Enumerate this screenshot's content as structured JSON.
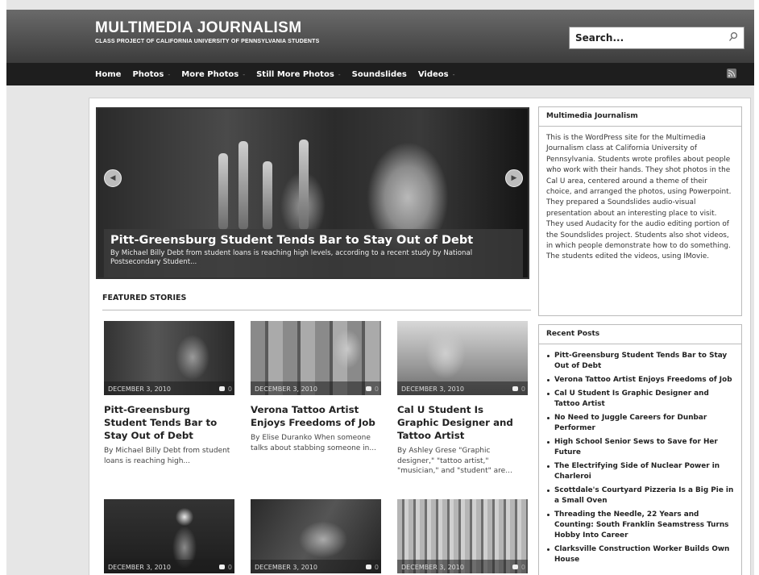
{
  "site": {
    "title": "MULTIMEDIA JOURNALISM",
    "tagline": "CLASS PROJECT OF CALIFORNIA UNIVERSITY OF PENNSYLVANIA STUDENTS"
  },
  "search": {
    "placeholder": "Search..."
  },
  "nav": {
    "items": [
      {
        "label": "Home",
        "has_dropdown": false
      },
      {
        "label": "Photos",
        "has_dropdown": true
      },
      {
        "label": "More Photos",
        "has_dropdown": true
      },
      {
        "label": "Still More Photos",
        "has_dropdown": true
      },
      {
        "label": "Soundslides",
        "has_dropdown": false
      },
      {
        "label": "Videos",
        "has_dropdown": true
      }
    ],
    "dropdown_glyph": "-",
    "rss_icon": "rss-icon"
  },
  "slider": {
    "title": "Pitt-Greensburg Student Tends Bar to Stay Out of Debt",
    "excerpt": "By Michael Billy Debt from student loans is reaching high levels, according to a recent study by National Postsecondary Student...",
    "prev_icon": "arrow-left-icon",
    "next_icon": "arrow-right-icon"
  },
  "featured": {
    "heading": "FEATURED STORIES",
    "cards": [
      {
        "date": "DECEMBER 3, 2010",
        "comments": "0",
        "title": "Pitt-Greensburg Student Tends Bar to Stay Out of Debt",
        "excerpt": "By Michael Billy Debt from student loans is reaching high..."
      },
      {
        "date": "DECEMBER 3, 2010",
        "comments": "0",
        "title": "Verona Tattoo Artist Enjoys Freedoms of Job",
        "excerpt": "By Elise Duranko When someone talks about stabbing someone in..."
      },
      {
        "date": "DECEMBER 3, 2010",
        "comments": "0",
        "title": "Cal U Student Is Graphic Designer and Tattoo Artist",
        "excerpt": "By Ashley Grese \"Graphic designer,\" \"tattoo artist,\" \"musician,\" and \"student\" are..."
      },
      {
        "date": "DECEMBER 3, 2010",
        "comments": "0",
        "title": "",
        "excerpt": ""
      },
      {
        "date": "DECEMBER 3, 2010",
        "comments": "0",
        "title": "",
        "excerpt": ""
      },
      {
        "date": "DECEMBER 3, 2010",
        "comments": "0",
        "title": "",
        "excerpt": ""
      }
    ]
  },
  "sidebar": {
    "about": {
      "title": "Multimedia Journalism",
      "body": "This is the WordPress site for the Multimedia Journalism class at California University of Pennsylvania. Students wrote profiles about people who work with their hands. They shot photos in the Cal U area, centered around a theme of their choice, and arranged the photos, using Powerpoint. They prepared a Soundslides audio-visual presentation about an interesting place to visit. They used Audacity for the audio editing portion of the Soundslides project. Students also shot videos, in which people demonstrate how to do something. The students edited the videos, using IMovie."
    },
    "recent_posts": {
      "title": "Recent Posts",
      "items": [
        "Pitt-Greensburg Student Tends Bar to Stay Out of Debt",
        "Verona Tattoo Artist Enjoys Freedoms of Job",
        "Cal U Student Is Graphic Designer and Tattoo Artist",
        "No Need to Juggle Careers for Dunbar Performer",
        "High School Senior Sews to Save for Her Future",
        "The Electrifying Side of Nuclear Power in Charleroi",
        "Scottdale's Courtyard Pizzeria Is a Big Pie in a Small Oven",
        "Threading the Needle, 22 Years and Counting: South Franklin Seamstress Turns Hobby Into Career",
        "Clarksville Construction Worker Builds Own House"
      ]
    }
  }
}
